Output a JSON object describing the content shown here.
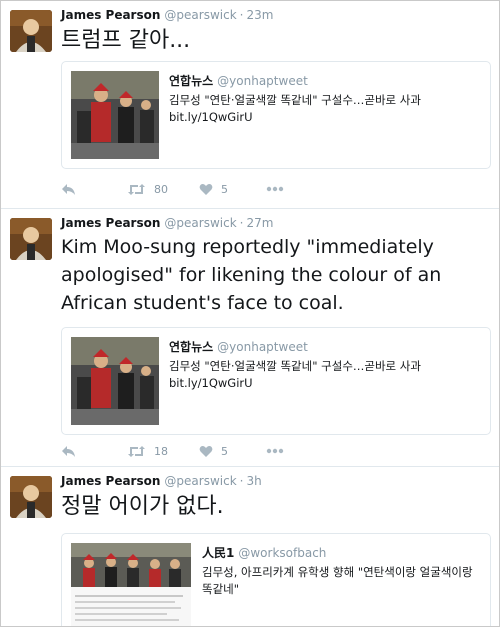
{
  "colors": {
    "name": "#14171a",
    "muted": "#8899a6",
    "action": "#aab8c2",
    "divider": "#e1e8ed"
  },
  "tweets": [
    {
      "author_name": "James Pearson",
      "author_handle": "@pearswick",
      "time": "23m",
      "text": "트럼프 같아...",
      "card": {
        "source_name": "연합뉴스",
        "source_handle": "@yonhaptweet",
        "line1": "김무성 \"연탄·얼굴색깔 똑같네\" 구설수…곧바로 사과",
        "line2": "bit.ly/1QwGirU"
      },
      "actions": {
        "reply_icon": "reply-icon",
        "retweet_icon": "retweet-icon",
        "retweets": "80",
        "like_icon": "heart-icon",
        "likes": "5",
        "more_icon": "more-icon"
      }
    },
    {
      "author_name": "James Pearson",
      "author_handle": "@pearswick",
      "time": "27m",
      "text": "Kim Moo-sung reportedly \"immediately apologised\" for likening the colour of an African student's face to coal.",
      "card": {
        "source_name": "연합뉴스",
        "source_handle": "@yonhaptweet",
        "line1": "김무성 \"연탄·얼굴색깔 똑같네\" 구설수…곧바로 사과",
        "line2": "bit.ly/1QwGirU"
      },
      "actions": {
        "reply_icon": "reply-icon",
        "retweet_icon": "retweet-icon",
        "retweets": "18",
        "like_icon": "heart-icon",
        "likes": "5",
        "more_icon": "more-icon"
      }
    },
    {
      "author_name": "James Pearson",
      "author_handle": "@pearswick",
      "time": "3h",
      "text": "정말 어이가 없다.",
      "card": {
        "source_name": "人民1",
        "source_handle": "@worksofbach",
        "line1": "김무성, 아프리카계 유학생 향해 \"연탄색이랑 얼굴색이랑 똑같네\"",
        "line2": ""
      }
    }
  ]
}
